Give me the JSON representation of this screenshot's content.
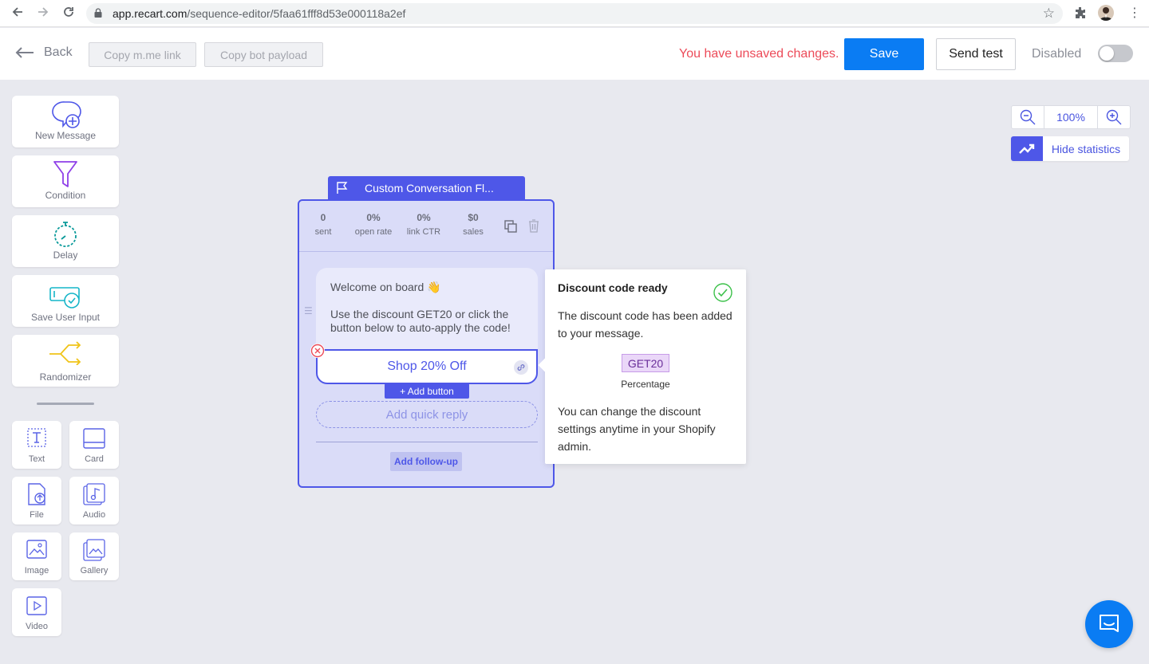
{
  "browser": {
    "url_host": "app.recart.com",
    "url_path": "/sequence-editor/5faa61fff8d53e000118a2ef"
  },
  "header": {
    "back_label": "Back",
    "copy_mme_label": "Copy m.me link",
    "copy_payload_label": "Copy bot payload",
    "unsaved_text": "You have unsaved changes.",
    "save_label": "Save",
    "send_test_label": "Send test",
    "status_label": "Disabled",
    "enabled": false
  },
  "palette": {
    "new_message": "New Message",
    "condition": "Condition",
    "delay": "Delay",
    "save_user_input": "Save User Input",
    "randomizer": "Randomizer",
    "text": "Text",
    "card": "Card",
    "file": "File",
    "audio": "Audio",
    "image": "Image",
    "gallery": "Gallery",
    "video": "Video"
  },
  "zoom": {
    "level": "100%",
    "hide_statistics": "Hide statistics"
  },
  "node": {
    "title": "Custom Conversation Fl...",
    "stats": [
      {
        "value": "0",
        "label": "sent"
      },
      {
        "value": "0%",
        "label": "open rate"
      },
      {
        "value": "0%",
        "label": "link CTR"
      },
      {
        "value": "$0",
        "label": "sales"
      }
    ],
    "message_greeting": "Welcome on board 👋",
    "message_body": "Use the discount GET20 or click the button below to auto-apply the code!",
    "button_label": "Shop 20% Off",
    "add_button_label": "+ Add button",
    "quick_reply_placeholder": "Add quick reply",
    "follow_up_label": "Add follow-up"
  },
  "popup": {
    "title": "Discount code ready",
    "text1": "The discount code has been added to your message.",
    "code": "GET20",
    "code_type": "Percentage",
    "text2": "You can change the discount settings anytime in your Shopify admin."
  },
  "colors": {
    "accent": "#4e57e8",
    "primary_button": "#0a7cf3",
    "warning": "#ec4b59",
    "canvas": "#e8e9ef"
  }
}
